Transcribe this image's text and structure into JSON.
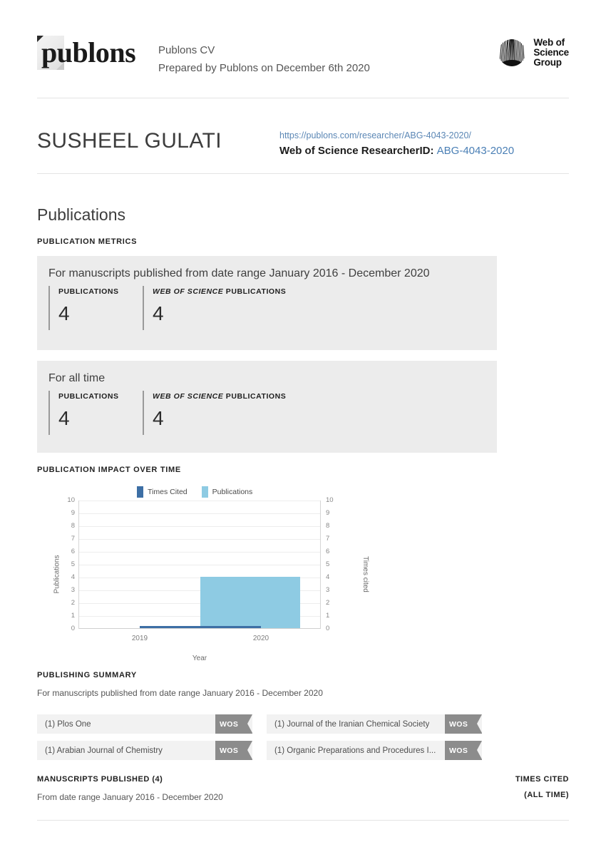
{
  "header": {
    "logo_word": "publons",
    "doc_title": "Publons CV",
    "prepared_line": "Prepared by Publons on December 6th 2020",
    "wos_logo_line1": "Web of",
    "wos_logo_line2": "Science",
    "wos_logo_line3": "Group"
  },
  "researcher": {
    "name": "SUSHEEL GULATI",
    "profile_url": "https://publons.com/researcher/ABG-4043-2020/",
    "researcher_id_label": "Web of Science ResearcherID:",
    "researcher_id": "ABG-4043-2020"
  },
  "publications_section": {
    "title": "Publications",
    "metrics_heading": "PUBLICATION METRICS",
    "impact_heading": "PUBLICATION IMPACT OVER TIME",
    "publishing_summary_heading": "PUBLISHING SUMMARY",
    "cards": [
      {
        "title": "For manuscripts published from date range January 2016 - December 2020",
        "metric_1_label": "PUBLICATIONS",
        "metric_1_value": "4",
        "metric_2_label_em": "WEB OF SCIENCE",
        "metric_2_label_rest": "PUBLICATIONS",
        "metric_2_value": "4"
      },
      {
        "title": "For all time",
        "metric_1_label": "PUBLICATIONS",
        "metric_1_value": "4",
        "metric_2_label_em": "WEB OF SCIENCE",
        "metric_2_label_rest": "PUBLICATIONS",
        "metric_2_value": "4"
      }
    ],
    "publishing_summary_note": "For manuscripts published from date range January 2016 - December 2020",
    "journals": [
      {
        "name": "(1) Plos One",
        "badge": "WOS"
      },
      {
        "name": "(1) Journal of the Iranian Chemical Society",
        "badge": "WOS"
      },
      {
        "name": "(1) Arabian Journal of Chemistry",
        "badge": "WOS"
      },
      {
        "name": "(1) Organic Preparations and Procedures I...",
        "badge": "WOS"
      }
    ]
  },
  "manuscripts": {
    "heading": "MANUSCRIPTS PUBLISHED (4)",
    "note": "From date range January 2016 - December 2020",
    "times_cited_heading": "TIMES CITED",
    "times_cited_sub": "(ALL TIME)"
  },
  "chart_data": {
    "type": "bar",
    "title": "PUBLICATION IMPACT OVER TIME",
    "xlabel": "Year",
    "ylabel": "Publications",
    "y2label": "Times cited",
    "categories": [
      "2019",
      "2020"
    ],
    "ylim": [
      0,
      10
    ],
    "y2lim": [
      0,
      10
    ],
    "yticks": [
      "10",
      "9",
      "8",
      "7",
      "6",
      "5",
      "4",
      "3",
      "2",
      "1",
      "0"
    ],
    "y2ticks": [
      "10",
      "9",
      "8",
      "7",
      "6",
      "5",
      "4",
      "3",
      "2",
      "1",
      "0"
    ],
    "grid": true,
    "legend_position": "top",
    "series": [
      {
        "name": "Times Cited",
        "type": "line",
        "color": "#3d6fa5",
        "values": [
          0,
          0
        ]
      },
      {
        "name": "Publications",
        "type": "bar",
        "color": "#8ecbe3",
        "values": [
          0,
          4
        ]
      }
    ]
  }
}
